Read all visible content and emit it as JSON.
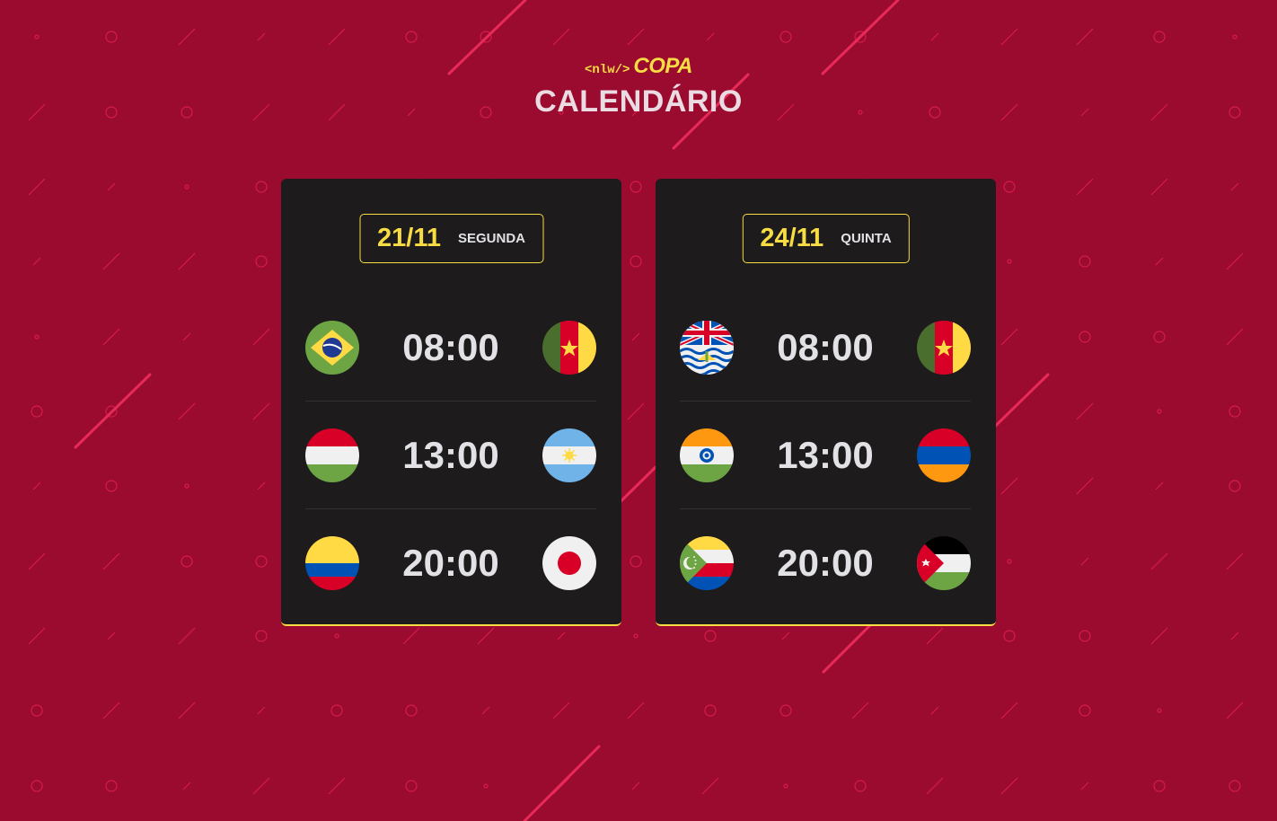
{
  "header": {
    "logo_code": "<nlw/>",
    "logo_brand": "COPA",
    "title": "CALENDÁRIO"
  },
  "colors": {
    "background": "#9b0b2f",
    "card": "#1e1b1c",
    "accent": "#f7dd43",
    "text": "#e1e1e6",
    "pattern": "#e0204f"
  },
  "cards": [
    {
      "date": "21/11",
      "weekday": "SEGUNDA",
      "matches": [
        {
          "home": "brazil-flag-icon",
          "time": "08:00",
          "away": "cameroon-flag-icon"
        },
        {
          "home": "hungary-flag-icon",
          "time": "13:00",
          "away": "argentina-flag-icon"
        },
        {
          "home": "colombia-flag-icon",
          "time": "20:00",
          "away": "japan-flag-icon"
        }
      ]
    },
    {
      "date": "24/11",
      "weekday": "QUINTA",
      "matches": [
        {
          "home": "british-indian-ocean-territory-flag-icon",
          "time": "08:00",
          "away": "cameroon-flag-icon"
        },
        {
          "home": "india-flag-icon",
          "time": "13:00",
          "away": "armenia-flag-icon"
        },
        {
          "home": "comoros-flag-icon",
          "time": "20:00",
          "away": "jordan-flag-icon"
        }
      ]
    }
  ]
}
